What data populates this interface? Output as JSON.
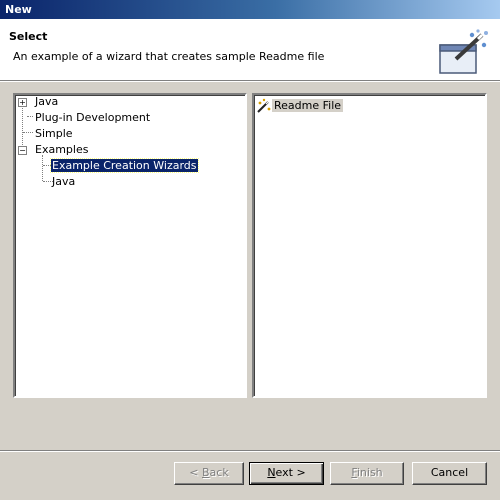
{
  "window": {
    "title": "New"
  },
  "header": {
    "title": "Select",
    "description": "An example of a wizard that creates sample Readme file",
    "banner_icon": "wizard-banner-icon"
  },
  "tree": {
    "items": [
      {
        "label": "Java",
        "expander": "+",
        "level": 0
      },
      {
        "label": "Plug-in Development",
        "expander": "",
        "level": 0
      },
      {
        "label": "Simple",
        "expander": "",
        "level": 0
      },
      {
        "label": "Examples",
        "expander": "−",
        "level": 0
      },
      {
        "label": "Example Creation Wizards",
        "expander": "",
        "level": 1,
        "selected": true
      },
      {
        "label": "Java",
        "expander": "",
        "level": 1
      }
    ]
  },
  "wizards_list": {
    "items": [
      {
        "label": "Readme File",
        "icon": "readme-wizard-icon"
      }
    ]
  },
  "buttons": {
    "back": {
      "pre": "< ",
      "mnemonic": "B",
      "post": "ack",
      "enabled": false
    },
    "next": {
      "pre": "",
      "mnemonic": "N",
      "post": "ext >",
      "enabled": true
    },
    "finish": {
      "pre": "",
      "mnemonic": "F",
      "post": "inish",
      "enabled": false
    },
    "cancel": {
      "label": "Cancel",
      "enabled": true
    }
  }
}
